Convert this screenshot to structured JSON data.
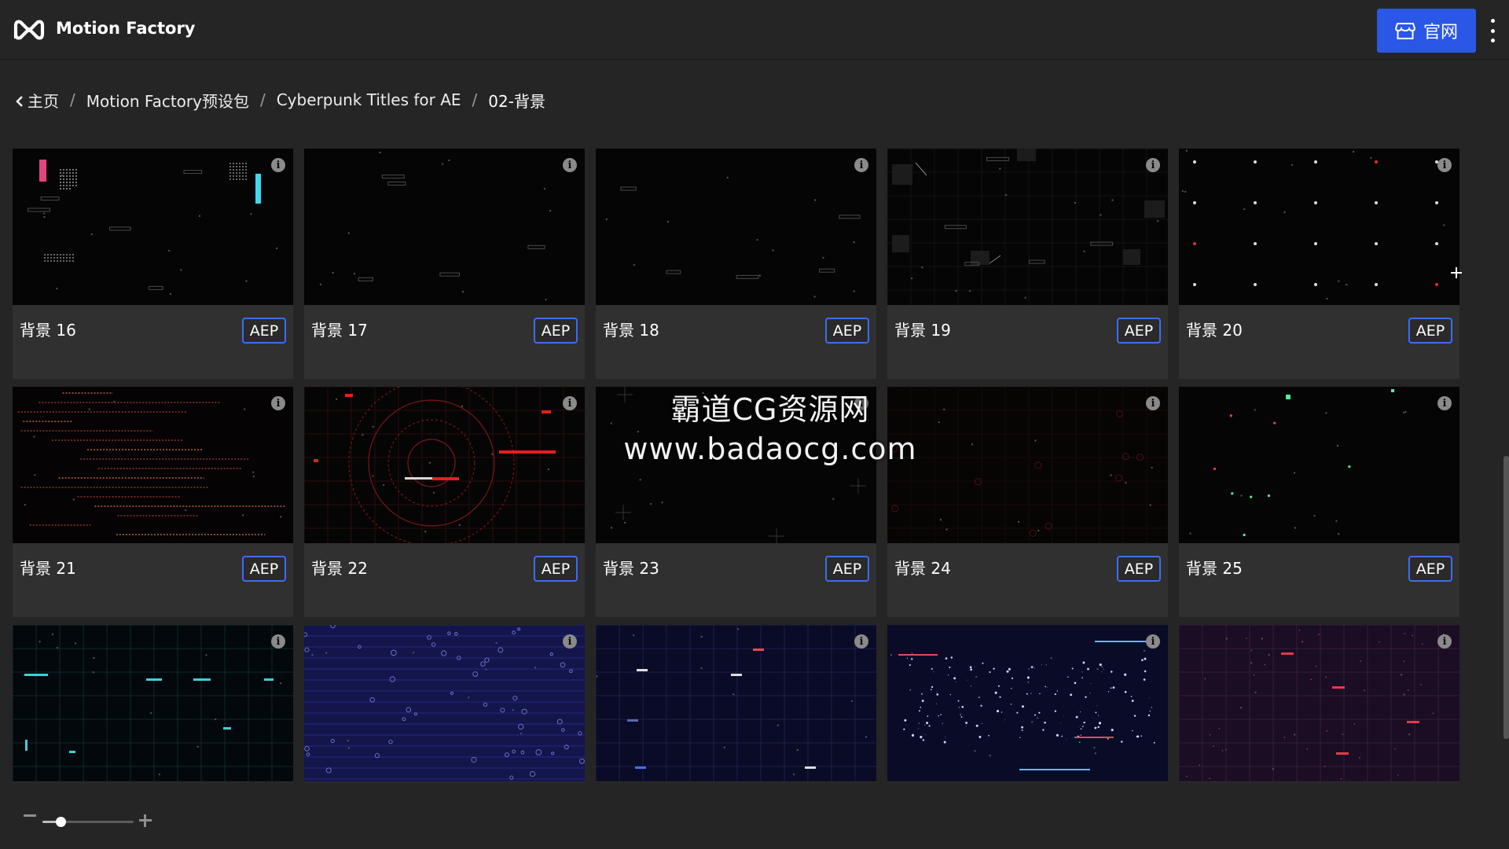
{
  "header": {
    "app_title": "Motion Factory",
    "official_label": "官网",
    "accent_color": "#2a57e6"
  },
  "breadcrumb": {
    "items": [
      "主页",
      "Motion Factory预设包",
      "Cyberpunk Titles for AE"
    ],
    "current": "02-背景",
    "separator": "/"
  },
  "cards": [
    {
      "title": "背景 16",
      "badge": "AEP",
      "thumb": "hud-pink-blue"
    },
    {
      "title": "背景 17",
      "badge": "AEP",
      "thumb": "sparse-labels"
    },
    {
      "title": "背景 18",
      "badge": "AEP",
      "thumb": "dim-text"
    },
    {
      "title": "背景 19",
      "badge": "AEP",
      "thumb": "boxes-grid"
    },
    {
      "title": "背景 20",
      "badge": "AEP",
      "thumb": "dot-grid"
    },
    {
      "title": "背景 21",
      "badge": "AEP",
      "thumb": "red-dotted-lines"
    },
    {
      "title": "背景 22",
      "badge": "AEP",
      "thumb": "red-radar"
    },
    {
      "title": "背景 23",
      "badge": "AEP",
      "thumb": "crosshair-sparse"
    },
    {
      "title": "背景 24",
      "badge": "AEP",
      "thumb": "dark-red-grid"
    },
    {
      "title": "背景 25",
      "badge": "AEP",
      "thumb": "green-points"
    },
    {
      "title": "",
      "badge": "",
      "thumb": "cyan-grid"
    },
    {
      "title": "",
      "badge": "",
      "thumb": "blue-data"
    },
    {
      "title": "",
      "badge": "",
      "thumb": "navy-grid"
    },
    {
      "title": "",
      "badge": "",
      "thumb": "star-field"
    },
    {
      "title": "",
      "badge": "",
      "thumb": "purple-grid"
    }
  ],
  "watermark": {
    "line1": "霸道CG资源网",
    "line2": "www.badaocg.com"
  },
  "zoom": {
    "level": 0.2
  },
  "icons": {
    "logo": "motion-factory-logo-icon",
    "store": "store-icon",
    "info": "info-icon",
    "more": "more-vertical-icon",
    "back": "chevron-left-icon"
  }
}
